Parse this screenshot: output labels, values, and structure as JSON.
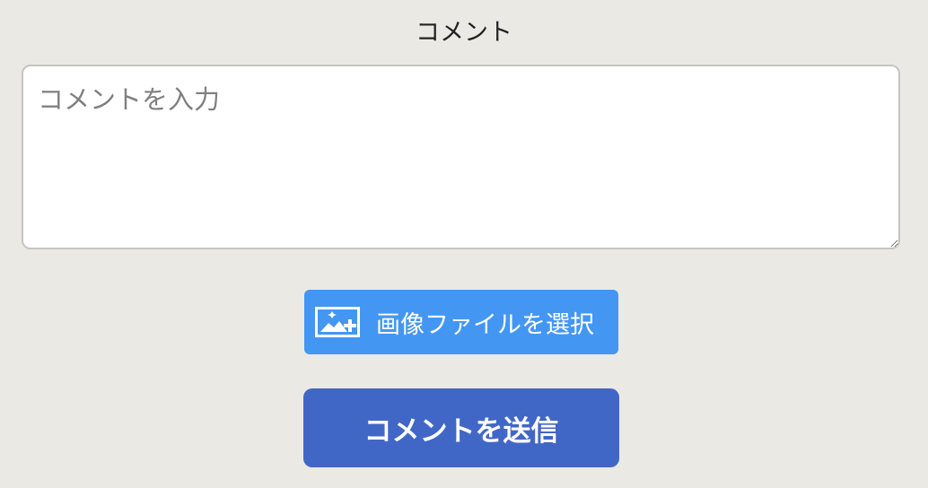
{
  "form": {
    "section_label": "コメント",
    "comment_placeholder": "コメントを入力",
    "comment_value": "",
    "image_button_label": "画像ファイルを選択",
    "image_button_icon": "add-image-icon",
    "submit_label": "コメントを送信"
  },
  "colors": {
    "background": "#ebe9e4",
    "file_button": "#4496f3",
    "submit_button": "#4167c6"
  }
}
